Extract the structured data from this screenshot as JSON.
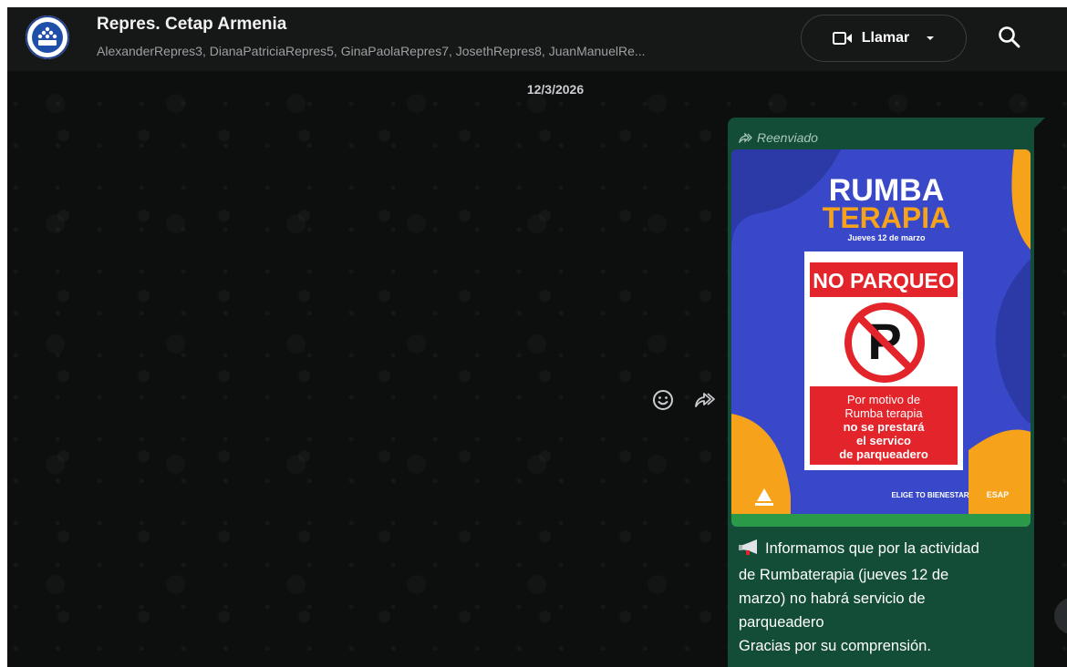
{
  "header": {
    "group_name": "Repres. Cetap Armenia",
    "members": "AlexanderRepres3, DianaPatriciaRepres5, GinaPaolaRepres7, JosethRepres8, JuanManuelRe...",
    "call_label": "Llamar",
    "icons": [
      "group-avatar",
      "video-call-icon",
      "chevron-down-icon",
      "search-icon"
    ]
  },
  "chat": {
    "date": "12/3/2026"
  },
  "message": {
    "forwarded_label": "Reenviado",
    "caption_lines": [
      "Informamos que por la actividad",
      "de Rumbaterapia (jueves 12 de",
      "marzo) no habrá servicio de",
      "parqueadero",
      "Gracias por su comprensión."
    ],
    "poster": {
      "title_top": "RUMBA",
      "title_bottom": "TERAPIA",
      "date": "Jueves 12 de marzo",
      "banner": "NO PARQUEO",
      "notice_lines": [
        "Por motivo de",
        "Rumba terapia",
        "no se prestará",
        "el servico",
        "de parqueadero"
      ],
      "logo_right": "ELIGE TO BIENESTAR",
      "logo_esap": "ESAP"
    }
  },
  "colors": {
    "bubble": "#134d37",
    "header_bg": "#161717",
    "poster_blue": "#3848c8",
    "poster_orange": "#f7a21b",
    "poster_red": "#e3242b"
  }
}
